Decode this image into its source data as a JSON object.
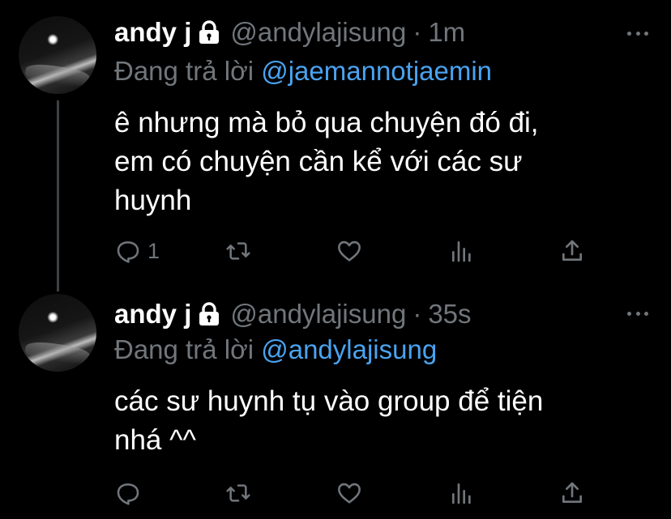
{
  "tweets": [
    {
      "name": "andy j",
      "handle": "@andylajisung",
      "time": "1m",
      "reply_prefix": "Đang trả lời",
      "reply_to": "@jaemannotjaemin",
      "text": "ê nhưng mà bỏ qua chuyện đó đi,\nem có chuyện cần kể với các sư\nhuynh",
      "reply_count": "1",
      "retweet_count": "",
      "like_count": ""
    },
    {
      "name": "andy j",
      "handle": "@andylajisung",
      "time": "35s",
      "reply_prefix": "Đang trả lời",
      "reply_to": "@andylajisung",
      "text": "các sư huynh tụ vào group để tiện\nnhá ^^",
      "reply_count": "",
      "retweet_count": "",
      "like_count": ""
    }
  ],
  "separator": "·",
  "icons": [
    "lock-icon",
    "more-icon",
    "reply-icon",
    "retweet-icon",
    "like-icon",
    "views-icon",
    "share-icon"
  ],
  "colors": {
    "background": "#000000",
    "text": "#ffffff",
    "muted": "#71767b",
    "mention": "#4aa3f0",
    "thread_line": "#3d4144"
  }
}
